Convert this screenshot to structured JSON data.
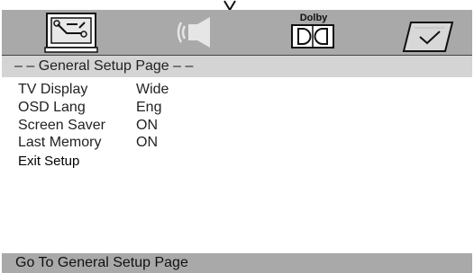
{
  "icons": {
    "general_setup": "wrench-monitor-icon",
    "audio_setup": "speaker-icon",
    "dolby_setup": "dolby-logo-icon",
    "preference": "checkmark-icon",
    "selector": "down-arrow-icon"
  },
  "dolby_tab": {
    "text": "Dolby"
  },
  "header": {
    "title": "– – General Setup Page – –"
  },
  "settings": [
    {
      "label": "TV Display",
      "value": "Wide"
    },
    {
      "label": "OSD Lang",
      "value": "Eng"
    },
    {
      "label": "Screen Saver",
      "value": "ON"
    },
    {
      "label": "Last Memory",
      "value": "ON"
    }
  ],
  "exit": {
    "label": "Exit Setup"
  },
  "status": {
    "text": "Go To General Setup Page"
  },
  "colors": {
    "bar_gray": "#a9a9a9",
    "header_gray": "#d4d4d4",
    "background": "#ffffff"
  }
}
